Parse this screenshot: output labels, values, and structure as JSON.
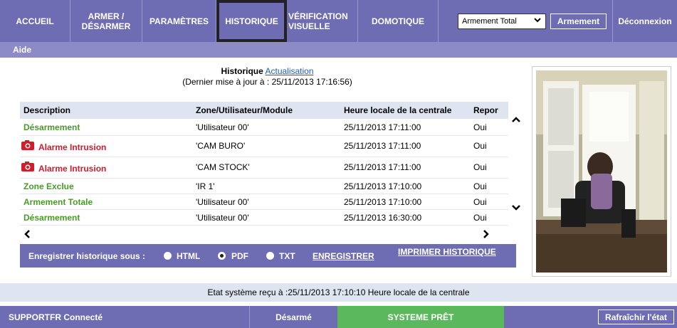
{
  "nav": {
    "tabs": [
      {
        "label_line1": "ACCUEIL",
        "label_line2": ""
      },
      {
        "label_line1": "ARMER /",
        "label_line2": "DÉSARMER"
      },
      {
        "label_line1": "PARAMÈTRES",
        "label_line2": ""
      },
      {
        "label_line1": "HISTORIQUE",
        "label_line2": ""
      },
      {
        "label_line1": "VÉRIFICATION",
        "label_line2": "VISUELLE"
      },
      {
        "label_line1": "DOMOTIQUE",
        "label_line2": ""
      }
    ],
    "mode_select_value": "Armement Total",
    "arm_button": "Armement",
    "logout": "Déconnexion"
  },
  "subnav": {
    "help": "Aide"
  },
  "history": {
    "title": "Historique",
    "refresh_link": "Actualisation",
    "last_update": "(Dernier mise à jour à : 25/11/2013 17:16:56)",
    "columns": [
      "Description",
      "Zone/Utilisateur/Module",
      "Heure locale de la centrale",
      "Repor"
    ],
    "rows": [
      {
        "description": "Désarmement",
        "zone": "'Utilisateur 00'",
        "time": "25/11/2013 17:11:00",
        "report": "Oui"
      },
      {
        "description": "Alarme Intrusion",
        "zone": "'CAM BURO'",
        "time": "25/11/2013 17:11:00",
        "report": "Oui"
      },
      {
        "description": "Alarme Intrusion",
        "zone": "'CAM STOCK'",
        "time": "25/11/2013 17:11:00",
        "report": "Oui"
      },
      {
        "description": "Zone Exclue",
        "zone": "'IR 1'",
        "time": "25/11/2013 17:10:00",
        "report": "Oui"
      },
      {
        "description": "Armement Totale",
        "zone": "'Utilisateur 00'",
        "time": "25/11/2013 17:10:00",
        "report": "Oui"
      },
      {
        "description": "Désarmement",
        "zone": "'Utilisateur 00'",
        "time": "25/11/2013 16:30:00",
        "report": "Oui"
      }
    ],
    "save_label": "Enregistrer historique sous :",
    "formats": [
      "HTML",
      "PDF",
      "TXT"
    ],
    "selected_format": "PDF",
    "save_button": "ENREGISTRER",
    "print_button": "IMPRIMER HISTORIQUE"
  },
  "status": {
    "received": "Etat système reçu à :25/11/2013 17:10:10 Heure locale de la centrale",
    "connection": "SUPPORTFR Connecté",
    "state": "Désarmé",
    "ready": "SYSTEME PRÊT",
    "refresh_button": "Rafraîchir l'état"
  },
  "colors": {
    "nav": "#6e6cb3",
    "subnav": "#8d8bc7",
    "ready": "#5cb85c",
    "alarm_text": "#d01c2b",
    "ok_text": "#4a9a2a"
  }
}
